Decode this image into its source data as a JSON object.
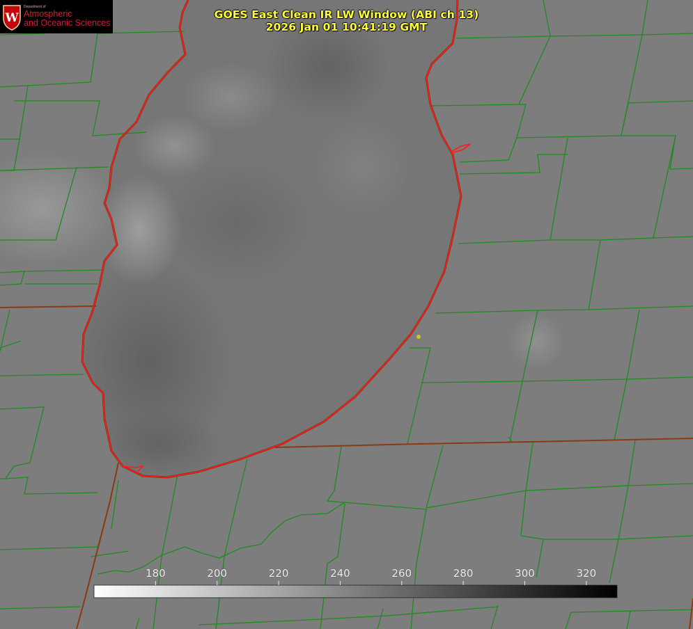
{
  "title": {
    "line1": "GOES East Clean IR LW Window (ABI ch 13)",
    "line2": "2026 Jan 01 10:41:19 GMT"
  },
  "logo": {
    "department": "Department of",
    "name_line1": "Atmospheric",
    "name_line2": "and Oceanic Sciences",
    "emblem_icon": "uw-crest-icon"
  },
  "colorbar": {
    "min": 160,
    "max": 330,
    "tick_values": [
      180,
      200,
      220,
      240,
      260,
      280,
      300,
      320
    ],
    "tick_labels": [
      "180",
      "200",
      "220",
      "240",
      "260",
      "280",
      "300",
      "320"
    ],
    "color_low": "#ffffff",
    "color_high": "#000000"
  },
  "colors": {
    "background_gray": "#7d7d7d",
    "lake_shore": "#ff1a1a",
    "county_lines": "#1f8a1f",
    "state_lines": "#8a3a12",
    "title_text": "#ffff37",
    "marker": "#d9c21a"
  },
  "map": {
    "feature": "Lake Michigan (southern basin)",
    "marker_icon": "city-dot-icon"
  }
}
